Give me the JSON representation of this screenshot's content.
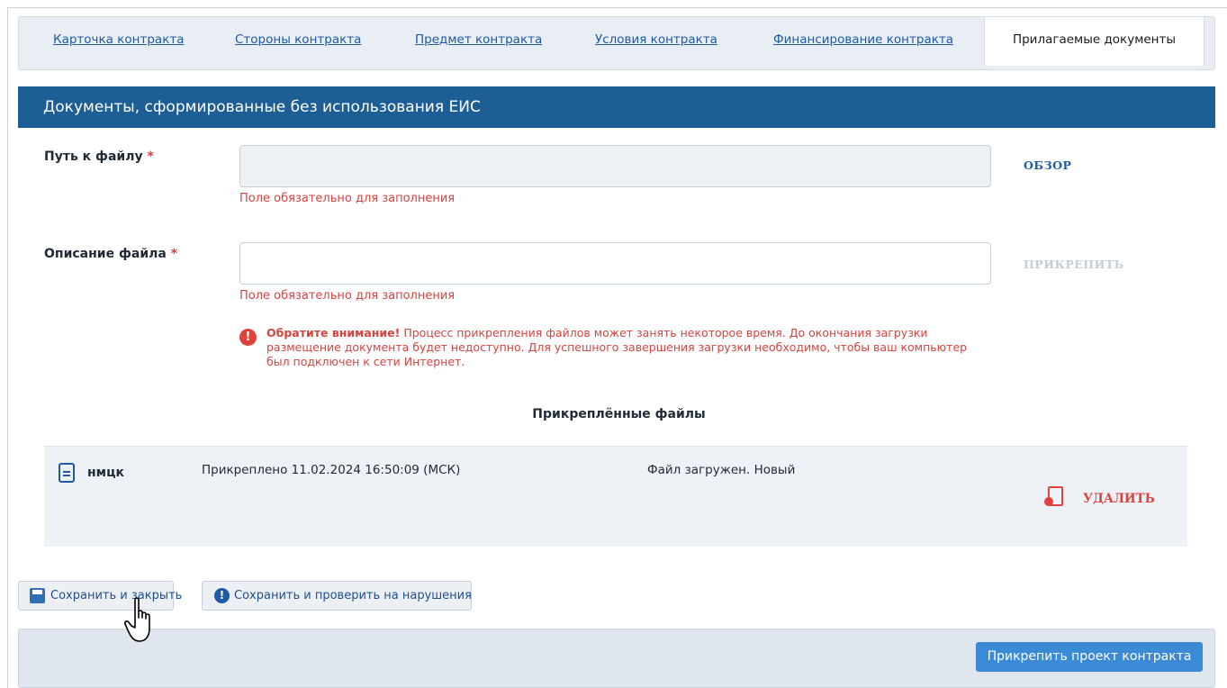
{
  "tabs": [
    {
      "label": "Карточка контракта"
    },
    {
      "label": "Стороны контракта"
    },
    {
      "label": "Предмет контракта"
    },
    {
      "label": "Условия контракта"
    },
    {
      "label": "Финансирование контракта"
    },
    {
      "label": "Прилагаемые документы",
      "active": true
    }
  ],
  "section": {
    "title": "Документы, сформированные без использования ЕИС"
  },
  "form": {
    "file_path_label": "Путь к файлу",
    "file_path_value": "",
    "file_desc_label": "Описание файла",
    "file_desc_value": "",
    "required_mark": "*",
    "required_error": "Поле обязательно для заполнения",
    "browse_label": "ОБЗОР",
    "attach_label": "ПРИКРЕПИТЬ"
  },
  "notice": {
    "title": "Обратите внимание!",
    "text": " Процесс прикрепления файлов может занять некоторое время. До окончания загрузки размещение документа будет недоступно. Для успешного завершения загрузки необходимо, чтобы ваш компьютер был подключен к сети Интернет."
  },
  "attached": {
    "title": "Прикреплённые файлы",
    "files": [
      {
        "name": "нмцк",
        "attached_at": "Прикреплено 11.02.2024 16:50:09 (МСК)",
        "status": "Файл загружен. Новый",
        "delete_label": "УДАЛИТЬ"
      }
    ]
  },
  "buttons": {
    "save_close": "Сохранить и закрыть",
    "save_check": "Сохранить и проверить на нарушения",
    "attach_project": "Прикрепить проект контракта"
  },
  "colors": {
    "header_bg": "#1e5e96",
    "link": "#1f5aa6",
    "error": "#d9423f",
    "primary": "#3a8ad6"
  }
}
